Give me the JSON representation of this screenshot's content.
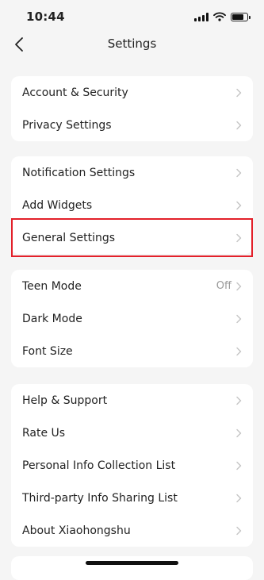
{
  "status": {
    "time": "10:44"
  },
  "nav": {
    "title": "Settings"
  },
  "groups": [
    {
      "items": [
        {
          "label": "Account & Security"
        },
        {
          "label": "Privacy Settings"
        }
      ]
    },
    {
      "items": [
        {
          "label": "Notification Settings"
        },
        {
          "label": "Add Widgets"
        },
        {
          "label": "General Settings"
        }
      ]
    },
    {
      "items": [
        {
          "label": "Teen Mode",
          "value": "Off"
        },
        {
          "label": "Dark Mode"
        },
        {
          "label": "Font Size"
        }
      ]
    },
    {
      "items": [
        {
          "label": "Help & Support"
        },
        {
          "label": "Rate Us"
        },
        {
          "label": "Personal Info Collection List"
        },
        {
          "label": "Third-party Info Sharing List"
        },
        {
          "label": "About Xiaohongshu"
        }
      ]
    }
  ],
  "highlight": {
    "target": "General Settings",
    "color": "#e3202a"
  },
  "icons": {
    "back": "chevron-left-icon",
    "chevron": "chevron-right-icon",
    "signal": "cellular-signal-icon",
    "wifi": "wifi-icon",
    "battery": "battery-icon"
  }
}
